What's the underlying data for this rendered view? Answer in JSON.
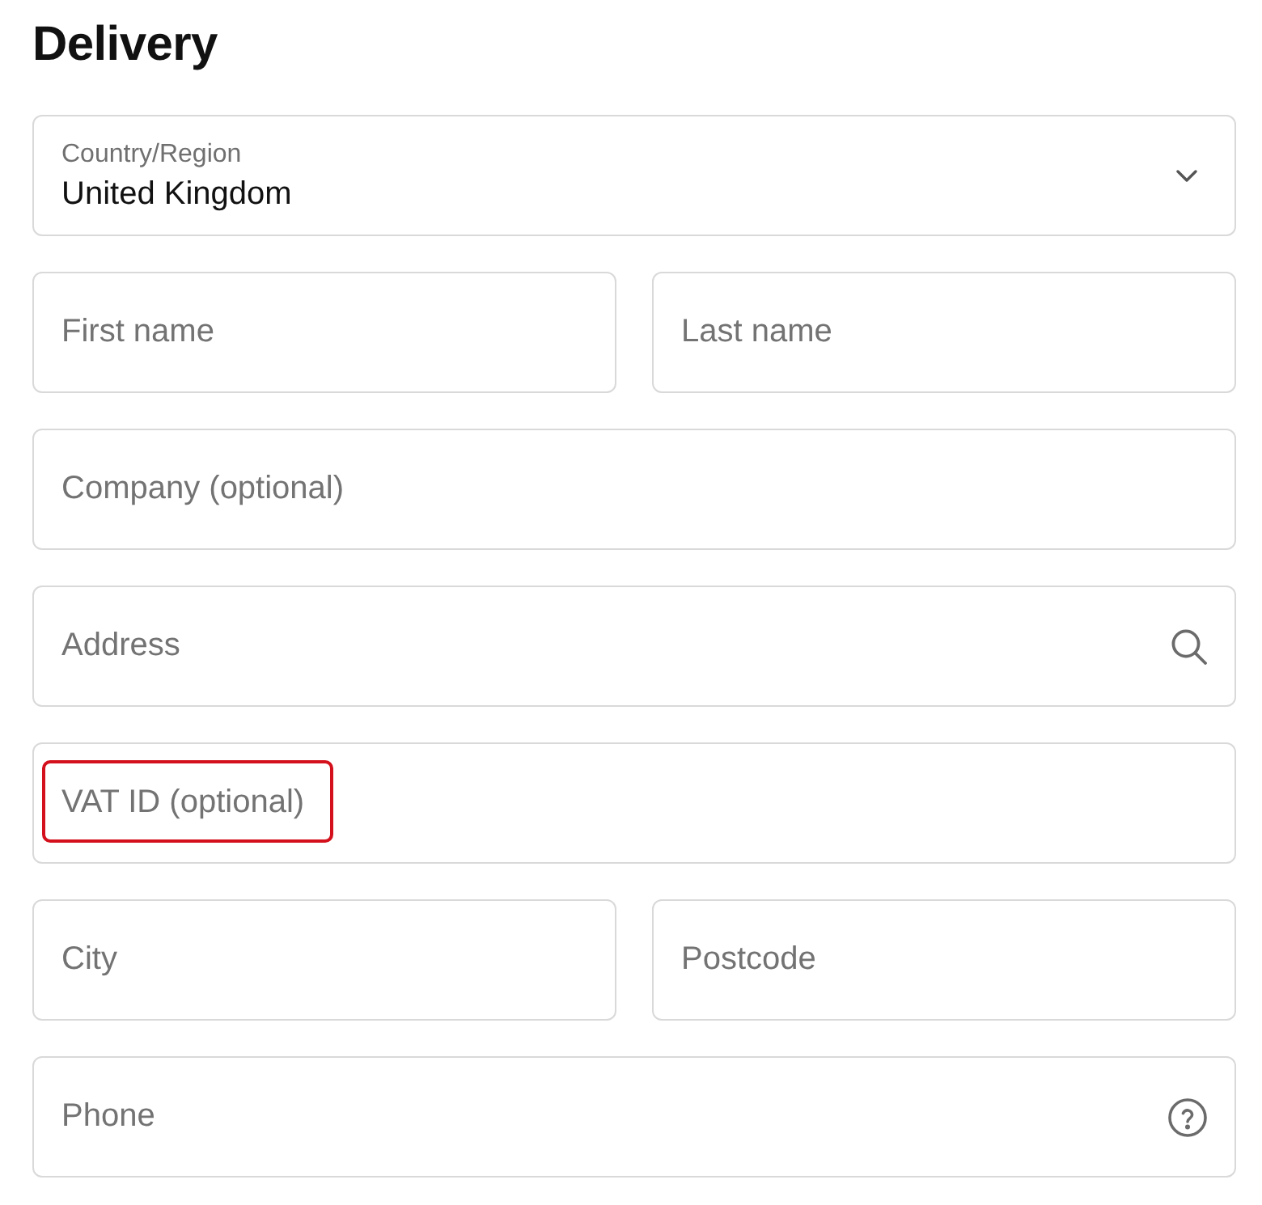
{
  "heading": "Delivery",
  "country_select": {
    "label": "Country/Region",
    "value": "United Kingdom"
  },
  "rows": [
    {
      "fields": [
        {
          "placeholder": "First name",
          "kind": "text",
          "highlighted": false
        },
        {
          "placeholder": "Last name",
          "kind": "text",
          "highlighted": false
        }
      ]
    },
    {
      "fields": [
        {
          "placeholder": "Company (optional)",
          "kind": "text",
          "highlighted": false
        }
      ]
    },
    {
      "fields": [
        {
          "placeholder": "Address",
          "kind": "search",
          "highlighted": false
        }
      ]
    },
    {
      "fields": [
        {
          "placeholder": "VAT ID (optional)",
          "kind": "text",
          "highlighted": true
        }
      ]
    },
    {
      "fields": [
        {
          "placeholder": "City",
          "kind": "text",
          "highlighted": false
        },
        {
          "placeholder": "Postcode",
          "kind": "text",
          "highlighted": false
        }
      ]
    },
    {
      "fields": [
        {
          "placeholder": "Phone",
          "kind": "help",
          "highlighted": false
        }
      ]
    }
  ]
}
